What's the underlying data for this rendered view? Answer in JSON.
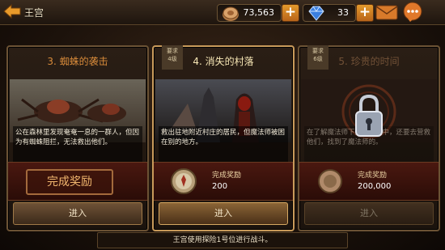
{
  "header": {
    "title": "王宫",
    "gold": "73,563",
    "gems": "33"
  },
  "cards": [
    {
      "title": "3. 蜘蛛的袭击",
      "description": "公在森林里发现奄奄一息的一群人，但因为有蜘蛛阻拦，无法救出他们。",
      "reward_status": "完成奖励",
      "enter_label": "进入",
      "state": "completed"
    },
    {
      "badge": "要求\n4级",
      "title": "4. 消失的村落",
      "description": "救出驻地附近村庄的居民，但魔法师被困在别的地方。",
      "reward_label": "完成奖励",
      "reward_value": "200",
      "enter_label": "进入",
      "state": "active"
    },
    {
      "badge": "要求\n6级",
      "title": "5. 珍贵的时间",
      "description": "在了解魔法师下落的过程中，还要去营救他们，找到了魔法师的。",
      "reward_label": "完成奖励",
      "reward_value": "200,000",
      "enter_label": "进入",
      "state": "locked"
    }
  ],
  "notice": "王宫使用探险1号位进行战斗。",
  "colors": {
    "accent": "#e49a2c",
    "reward_bg": "#4a1810",
    "title_active": "#f7e7b5",
    "title_completed": "#d88b3a"
  }
}
